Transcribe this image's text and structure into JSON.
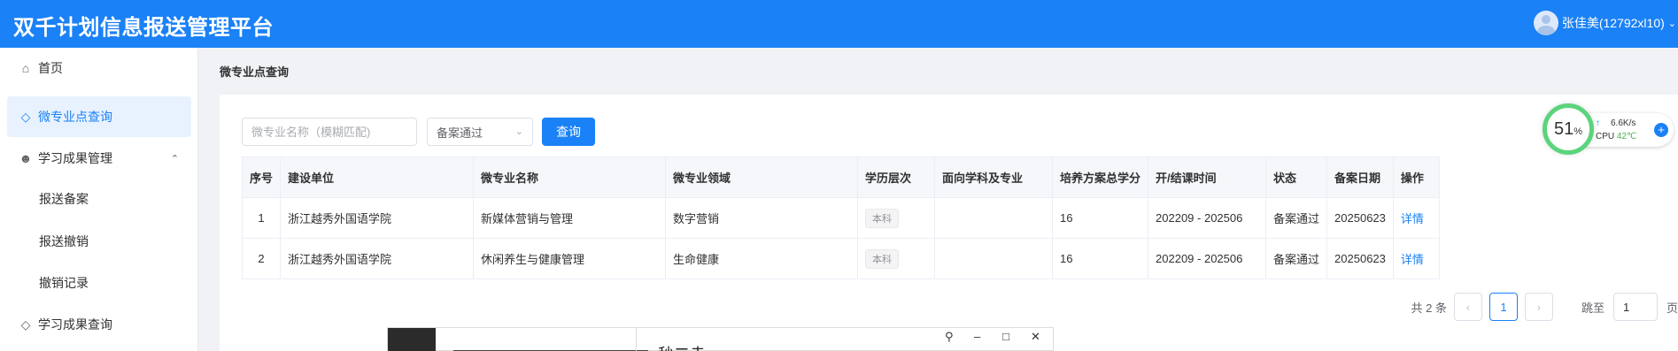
{
  "app": {
    "title": "双千计划信息报送管理平台",
    "user": "张佳美(12792xl10)"
  },
  "sidebar": {
    "items": [
      {
        "label": "首页",
        "icon": "home-icon"
      },
      {
        "label": "微专业点查询",
        "icon": "layers-icon",
        "active": true
      },
      {
        "label": "学习成果管理",
        "icon": "user-group-icon",
        "expanded": true
      },
      {
        "label": "报送备案"
      },
      {
        "label": "报送撤销"
      },
      {
        "label": "撤销记录"
      },
      {
        "label": "学习成果查询",
        "icon": "layers-icon"
      }
    ]
  },
  "main": {
    "breadcrumb": "微专业点查询",
    "search": {
      "placeholder": "微专业名称（模糊匹配)",
      "value": ""
    },
    "status_select": {
      "value": "备案通过"
    },
    "query_button": "查询",
    "table": {
      "headers": [
        "序号",
        "建设单位",
        "微专业名称",
        "微专业领域",
        "学历层次",
        "面向学科及专业",
        "培养方案总学分",
        "开/结课时间",
        "状态",
        "备案日期",
        "操作"
      ],
      "rows": [
        {
          "index": "1",
          "unit": "浙江越秀外国语学院",
          "name": "新媒体营销与管理",
          "field": "数字营销",
          "level": "本科",
          "discipline": "",
          "credits": "16",
          "period": "202209 - 202506",
          "status": "备案通过",
          "date": "20250623",
          "action": "详情"
        },
        {
          "index": "2",
          "unit": "浙江越秀外国语学院",
          "name": "休闲养生与健康管理",
          "field": "生命健康",
          "level": "本科",
          "discipline": "",
          "credits": "16",
          "period": "202209 - 202506",
          "status": "备案通过",
          "date": "20250623",
          "action": "详情"
        }
      ]
    },
    "pagination": {
      "total_text": "共 2 条",
      "current_page": "1",
      "jump_label": "跳至",
      "jump_value": "1",
      "page_unit": "页"
    }
  },
  "perf_widget": {
    "percent": "51",
    "percent_unit": "%",
    "net_speed": "6.6K/s",
    "cpu_label": "CPU",
    "cpu_temp": "42℃"
  },
  "overlay_window": {
    "title_fragment": "秒二赤"
  },
  "colors": {
    "primary": "#1a81f6",
    "active_bg": "#e8f2fe",
    "ring": "#5bd47c"
  }
}
